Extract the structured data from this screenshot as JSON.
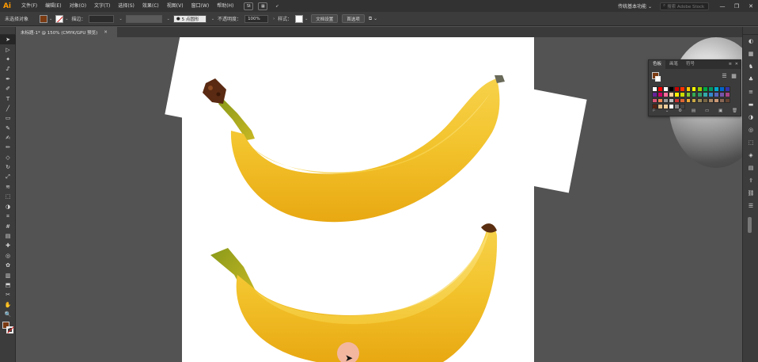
{
  "app": {
    "logo": "Ai",
    "menu": [
      "文件(F)",
      "编辑(E)",
      "对象(O)",
      "文字(T)",
      "选择(S)",
      "效果(C)",
      "视图(V)",
      "窗口(W)",
      "帮助(H)"
    ],
    "bridge_icon": "St",
    "workspace_label": "传统基本功能",
    "search_placeholder": "搜索 Adobe Stock",
    "window_buttons": [
      "—",
      "❐",
      "✕"
    ]
  },
  "control_bar": {
    "selection_label": "未选择对象",
    "fill_color": "#7a3a12",
    "stroke_label": "描边：",
    "stroke_value": "",
    "brush_value": "5 点圆形",
    "opacity_label": "不透明度：",
    "opacity_value": "100%",
    "style_label": "样式：",
    "doc_setup_label": "文档设置",
    "prefs_label": "首选项"
  },
  "document": {
    "tab_title": "未标题-1* @ 150% (CMYK/GPU 预览)",
    "tab_close": "✕"
  },
  "tools": [
    "selection-tool",
    "direct-selection-tool",
    "magic-wand-tool",
    "lasso-tool",
    "pen-tool",
    "curvature-tool",
    "type-tool",
    "line-segment-tool",
    "rectangle-tool",
    "paintbrush-tool",
    "shaper-tool",
    "pencil-tool",
    "eraser-tool",
    "rotate-tool",
    "scale-tool",
    "width-tool",
    "free-transform-tool",
    "shape-builder-tool",
    "perspective-grid-tool",
    "mesh-tool",
    "gradient-tool",
    "eyedropper-tool",
    "blend-tool",
    "symbol-sprayer-tool",
    "column-graph-tool",
    "artboard-tool",
    "slice-tool",
    "hand-tool",
    "zoom-tool"
  ],
  "tool_glyphs": [
    "➤",
    "▷",
    "✦",
    "ᔑ",
    "✒",
    "✐",
    "T",
    "╱",
    "▭",
    "✎",
    "✍",
    "✏",
    "◇",
    "↻",
    "⤢",
    "≋",
    "⬚",
    "◑",
    "⌗",
    "#",
    "▤",
    "✚",
    "◎",
    "✿",
    "▥",
    "⬒",
    "✂",
    "✋",
    "🔍"
  ],
  "swatch_panel": {
    "tabs": [
      "色板",
      "画笔",
      "符号"
    ],
    "close": "✕",
    "menu": "≡",
    "swatches": [
      "#ffffff",
      "#ff0000",
      "#ffffff",
      "#000000",
      "#cc0000",
      "#ff3300",
      "#ffcc00",
      "#ffff00",
      "#99cc00",
      "#00aa44",
      "#009966",
      "#00aacc",
      "#0066cc",
      "#3333aa",
      "#662299",
      "#cc0066",
      "#ff6699",
      "#ffcc99",
      "#ffee00",
      "#ccdd00",
      "#88cc33",
      "#33aa55",
      "#339966",
      "#33aaaa",
      "#3388cc",
      "#5566bb",
      "#7755aa",
      "#aa4488",
      "#dd5577",
      "#ee8855",
      "#999999",
      "#bbbbbb",
      "#cc3333",
      "#dd6633",
      "#eeaa33",
      "#ccaa44",
      "#998855",
      "#776644",
      "#aa8866",
      "#cc9977",
      "#886655",
      "#664433",
      "#552211",
      "#ddbb88",
      "#eecc99",
      "#ffffff",
      "#888888",
      "#444444"
    ],
    "bottom_icons": [
      "swatch-library-icon",
      "show-kinds-icon",
      "swatch-options-icon",
      "color-group-icon",
      "new-group-icon",
      "new-swatch-icon",
      "delete-swatch-icon"
    ]
  },
  "dock_icons": [
    "color-icon",
    "color-guide-icon",
    "brushes-icon",
    "symbols-icon",
    "stroke-icon",
    "gradient-icon",
    "transparency-icon",
    "appearance-icon",
    "graphic-styles-icon",
    "layers-icon",
    "artboards-icon",
    "asset-export-icon",
    "links-icon",
    "properties-icon"
  ],
  "dock_glyphs": [
    "◐",
    "▦",
    "♞",
    "♣",
    "≡",
    "▬",
    "◑",
    "◎",
    "⬚",
    "◈",
    "▤",
    "⇪",
    "⛓",
    "☰"
  ]
}
